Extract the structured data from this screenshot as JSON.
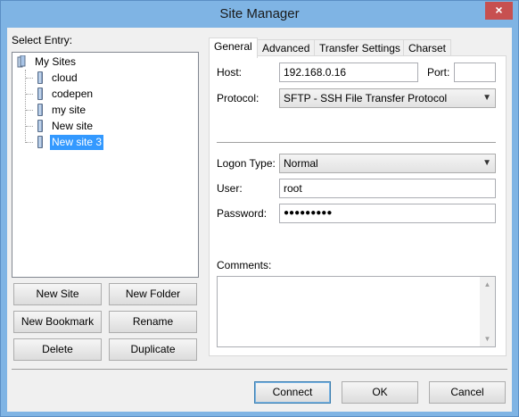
{
  "window": {
    "title": "Site Manager",
    "close_icon": "×"
  },
  "left": {
    "select_entry_label": "Select Entry:",
    "tree": {
      "root": "My Sites",
      "children": [
        "cloud",
        "codepen",
        "my site",
        "New site",
        "New site 3"
      ],
      "selected": "New site 3"
    },
    "buttons": {
      "new_site": "New Site",
      "new_folder": "New Folder",
      "new_bookmark": "New Bookmark",
      "rename": "Rename",
      "delete": "Delete",
      "duplicate": "Duplicate"
    }
  },
  "tabs": [
    "General",
    "Advanced",
    "Transfer Settings",
    "Charset"
  ],
  "active_tab": "General",
  "general": {
    "host_label": "Host:",
    "host_value": "192.168.0.16",
    "port_label": "Port:",
    "port_value": "",
    "protocol_label": "Protocol:",
    "protocol_value": "SFTP - SSH File Transfer Protocol",
    "logon_type_label": "Logon Type:",
    "logon_type_value": "Normal",
    "user_label": "User:",
    "user_value": "root",
    "password_label": "Password:",
    "password_value": "●●●●●●●●●",
    "comments_label": "Comments:",
    "comments_value": ""
  },
  "footer": {
    "connect": "Connect",
    "ok": "OK",
    "cancel": "Cancel"
  },
  "colors": {
    "titlebar": "#7fb4e4",
    "selection": "#3399ff",
    "close_button": "#c75050"
  }
}
